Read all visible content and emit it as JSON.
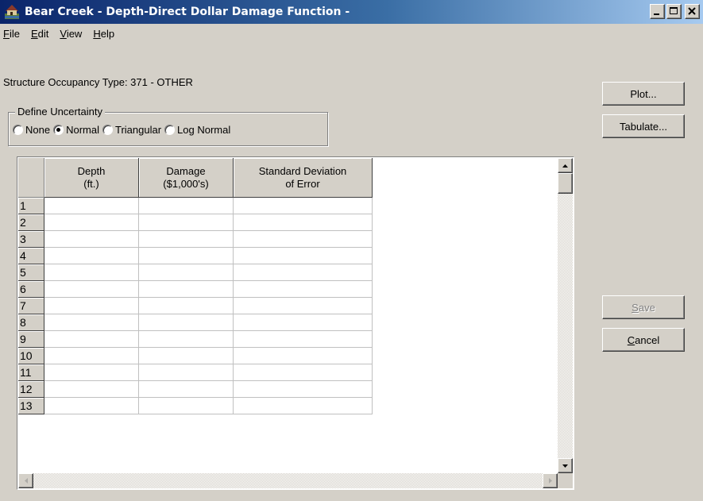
{
  "window": {
    "title": "Bear Creek - Depth-Direct Dollar Damage Function -",
    "controls": [
      "minimize-icon",
      "maximize-icon",
      "close-icon"
    ]
  },
  "menu": {
    "file": {
      "first": "F",
      "rest": "ile"
    },
    "edit": {
      "first": "E",
      "rest": "dit"
    },
    "view": {
      "first": "V",
      "rest": "iew"
    },
    "help": {
      "first": "H",
      "rest": "elp"
    }
  },
  "occupancy": {
    "text": "Structure Occupancy Type:  371 - OTHER"
  },
  "uncertainty": {
    "legend": "Define Uncertainty",
    "options": [
      {
        "label": "None",
        "selected": false
      },
      {
        "label": "Normal",
        "selected": true
      },
      {
        "label": "Triangular",
        "selected": false
      },
      {
        "label": "Log Normal",
        "selected": false
      }
    ]
  },
  "buttons": {
    "plot": "Plot...",
    "tabulate": "Tabulate...",
    "save": {
      "first": "S",
      "rest": "ave",
      "enabled": false
    },
    "cancel": {
      "first": "C",
      "rest": "ancel",
      "enabled": true
    }
  },
  "grid": {
    "columns": [
      {
        "line1": "Depth",
        "line2": "(ft.)"
      },
      {
        "line1": "Damage",
        "line2": "($1,000's)"
      },
      {
        "line1": "Standard Deviation",
        "line2": "of Error"
      }
    ],
    "rows": [
      "1",
      "2",
      "3",
      "4",
      "5",
      "6",
      "7",
      "8",
      "9",
      "10",
      "11",
      "12",
      "13"
    ],
    "values": [
      [
        "",
        "",
        ""
      ],
      [
        "",
        "",
        ""
      ],
      [
        "",
        "",
        ""
      ],
      [
        "",
        "",
        ""
      ],
      [
        "",
        "",
        ""
      ],
      [
        "",
        "",
        ""
      ],
      [
        "",
        "",
        ""
      ],
      [
        "",
        "",
        ""
      ],
      [
        "",
        "",
        ""
      ],
      [
        "",
        "",
        ""
      ],
      [
        "",
        "",
        ""
      ],
      [
        "",
        "",
        ""
      ],
      [
        "",
        "",
        ""
      ]
    ]
  },
  "colors": {
    "titlebar_start": "#0a246a",
    "titlebar_end": "#a6caf0",
    "face": "#d4d0c8"
  }
}
